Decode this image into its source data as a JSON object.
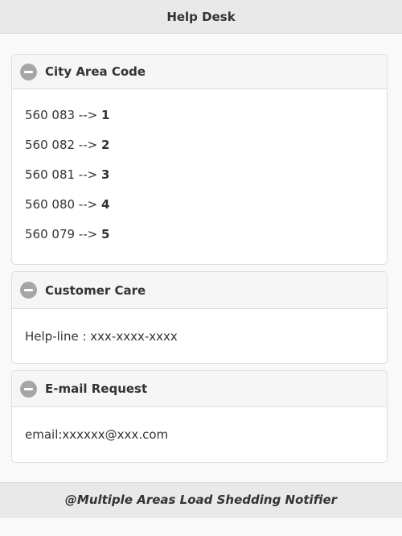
{
  "header": {
    "title": "Help Desk"
  },
  "sections": [
    {
      "title": "City Area Code",
      "icon": "minus-icon",
      "items": [
        {
          "prefix": "560 083 --> ",
          "value": "1"
        },
        {
          "prefix": "560 082 --> ",
          "value": "2"
        },
        {
          "prefix": "560 081 --> ",
          "value": "3"
        },
        {
          "prefix": "560 080 --> ",
          "value": "4"
        },
        {
          "prefix": "560 079 --> ",
          "value": "5"
        }
      ]
    },
    {
      "title": "Customer Care",
      "icon": "minus-icon",
      "text": "Help-line : xxx-xxxx-xxxx"
    },
    {
      "title": "E-mail Request",
      "icon": "minus-icon",
      "text": "email:xxxxxx@xxx.com"
    }
  ],
  "footer": {
    "text": "@Multiple Areas Load Shedding Notifier"
  },
  "colors": {
    "header_bg": "#e9e9e9",
    "section_head_bg": "#f6f6f6",
    "icon_bg": "#a6a6a6",
    "page_bg": "#f9f9f9"
  }
}
